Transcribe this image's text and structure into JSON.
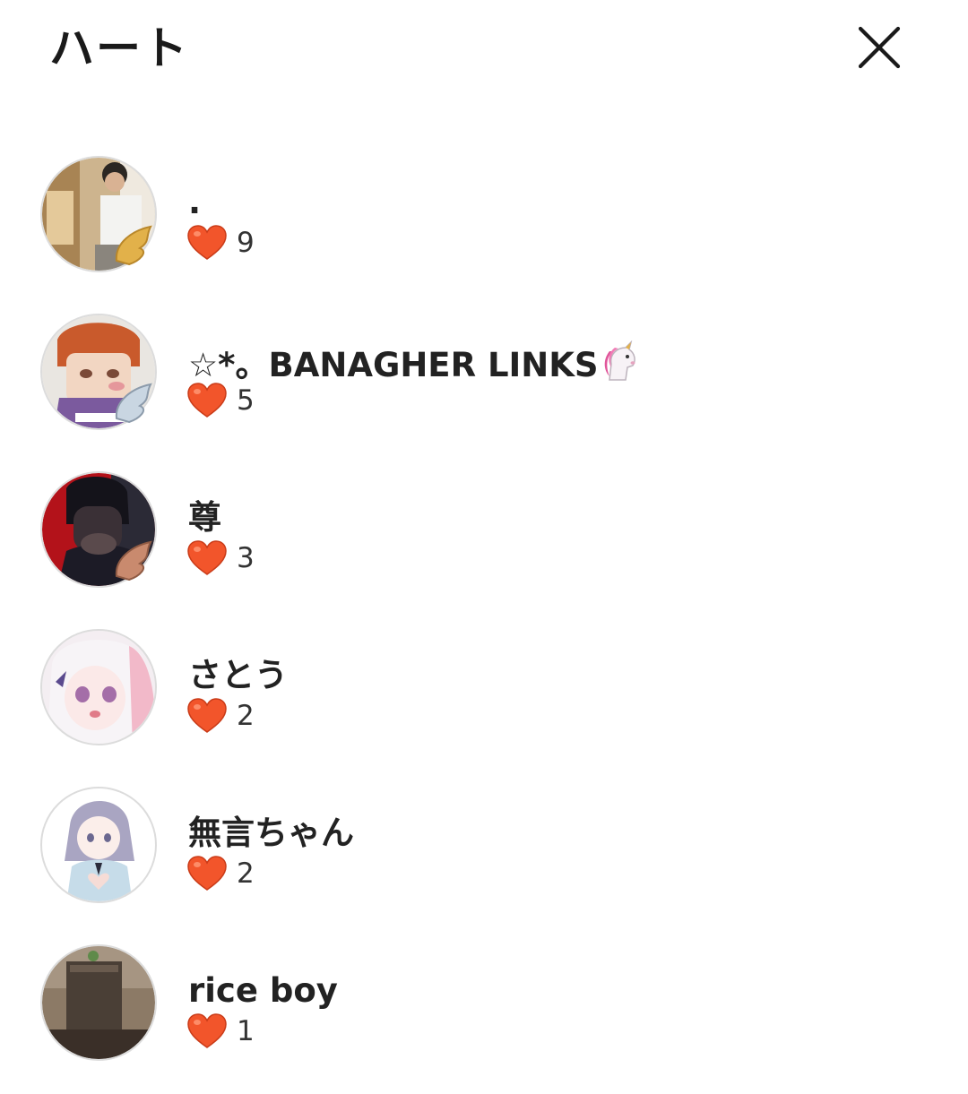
{
  "header": {
    "title": "ハート",
    "close_icon": "close-icon"
  },
  "colors": {
    "heart": "#f2552b",
    "text": "#222222",
    "avatar_border": "#dcdcdc"
  },
  "users": [
    {
      "name": ".",
      "hearts": "9",
      "avatar": "avatar-photo-person",
      "badge": "gold-wing-badge"
    },
    {
      "name": "☆*。BANAGHER LINKS",
      "name_emoji": "unicorn-icon",
      "hearts": "5",
      "avatar": "avatar-drawing",
      "badge": "silver-wing-badge"
    },
    {
      "name": "尊",
      "hearts": "3",
      "avatar": "avatar-dark-red",
      "badge": "bronze-wing-badge"
    },
    {
      "name": "さとう",
      "hearts": "2",
      "avatar": "avatar-anime-girl",
      "badge": ""
    },
    {
      "name": "無言ちゃん",
      "hearts": "2",
      "avatar": "avatar-anime-girl-blue",
      "badge": ""
    },
    {
      "name": "rice boy",
      "hearts": "1",
      "avatar": "avatar-photo-object",
      "badge": ""
    }
  ]
}
